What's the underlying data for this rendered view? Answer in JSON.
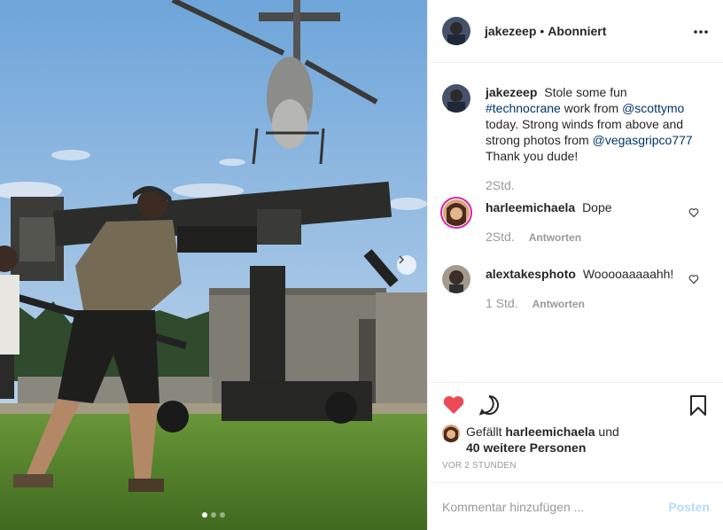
{
  "header": {
    "username": "jakezeep",
    "separator": "•",
    "follow_status": "Abonniert",
    "more_icon": "more-horizontal-icon"
  },
  "caption": {
    "username": "jakezeep",
    "text_1": "Stole some fun",
    "tag_1": "#technocrane",
    "text_2": "work from",
    "tag_2": "@scottymo",
    "text_3": "today. Strong winds from above and strong photos from",
    "tag_3": "@vegasgripco777",
    "text_4": "Thank you dude!",
    "time": "2Std."
  },
  "comments": [
    {
      "username": "harleemichaela",
      "text": "Dope",
      "time": "2Std.",
      "reply": "Antworten"
    },
    {
      "username": "alextakesphoto",
      "text": "Wooooaaaaahh!",
      "time": "1 Std.",
      "reply": "Antworten"
    }
  ],
  "likes": {
    "prefix": "Gefällt",
    "user": "harleemichaela",
    "conjunction": "und",
    "others": "40 weitere Personen",
    "liked": true
  },
  "timestamp": "VOR 2 STUNDEN",
  "add_comment": {
    "placeholder": "Kommentar hinzufügen ...",
    "post_label": "Posten"
  },
  "carousel": {
    "slide_count": 3,
    "active_slide": 1
  },
  "colors": {
    "like_red": "#ed4956",
    "link_blue": "#003569",
    "post_disabled": "#b3dbff",
    "meta_gray": "#999999"
  }
}
